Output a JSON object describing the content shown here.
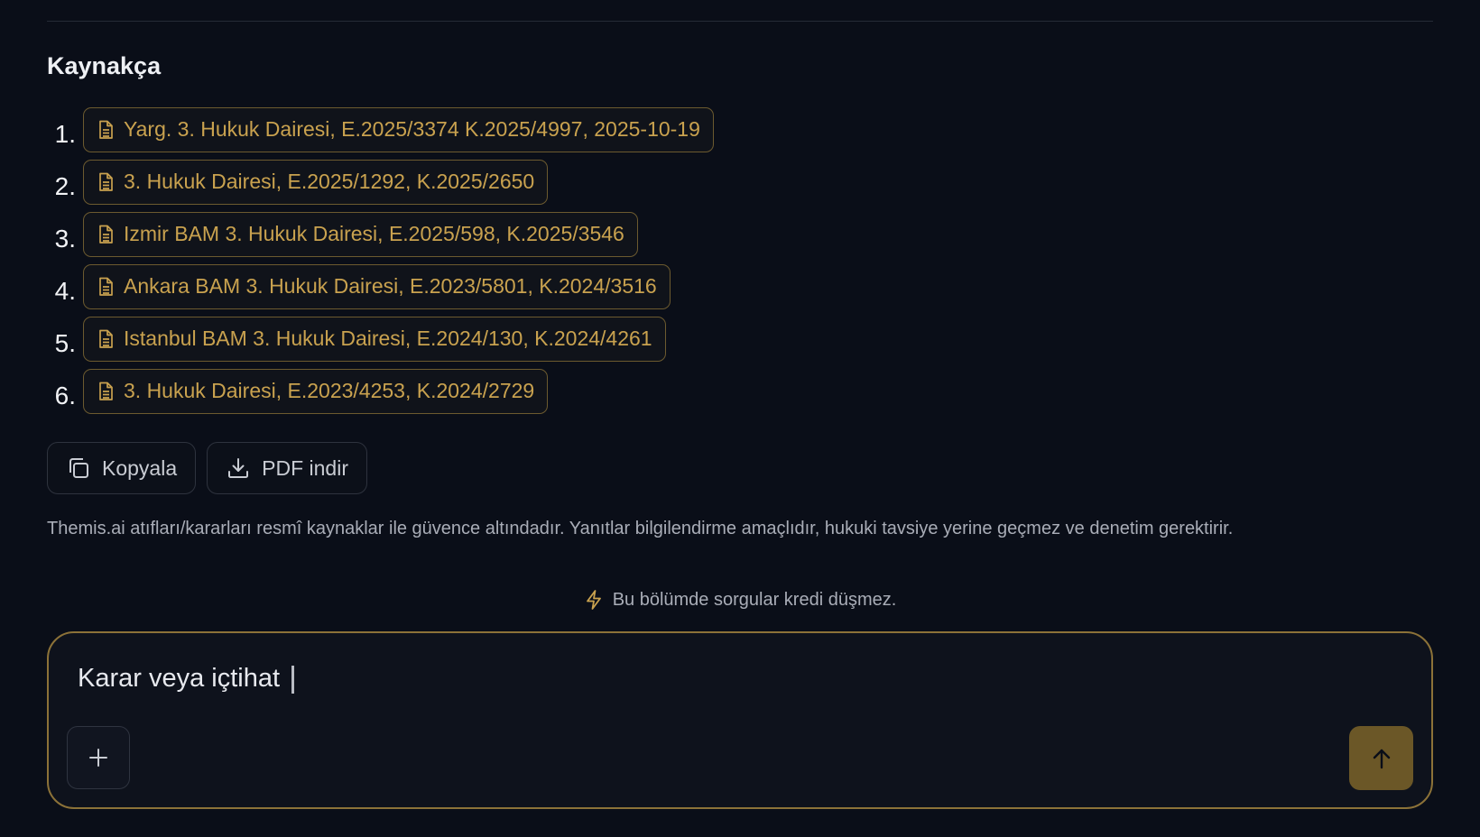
{
  "references": {
    "title": "Kaynakça",
    "items": [
      {
        "num": "1.",
        "label": "Yarg. 3. Hukuk Dairesi, E.2025/3374 K.2025/4997, 2025-10-19",
        "icon": "document-icon"
      },
      {
        "num": "2.",
        "label": "3. Hukuk Dairesi, E.2025/1292, K.2025/2650",
        "icon": "document-icon"
      },
      {
        "num": "3.",
        "label": "Izmir BAM 3. Hukuk Dairesi, E.2025/598, K.2025/3546",
        "icon": "document-icon"
      },
      {
        "num": "4.",
        "label": "Ankara BAM 3. Hukuk Dairesi, E.2023/5801, K.2024/3516",
        "icon": "document-icon"
      },
      {
        "num": "5.",
        "label": "Istanbul BAM 3. Hukuk Dairesi, E.2024/130, K.2024/4261",
        "icon": "document-icon"
      },
      {
        "num": "6.",
        "label": "3. Hukuk Dairesi, E.2023/4253, K.2024/2729",
        "icon": "document-icon"
      }
    ]
  },
  "actions": {
    "copy_label": "Kopyala",
    "copy_icon": "copy-icon",
    "pdf_label": "PDF indir",
    "pdf_icon": "download-icon"
  },
  "disclaimer": "Themis.ai atıfları/kararları resmî kaynaklar ile güvence altındadır. Yanıtlar bilgilendirme amaçlıdır, hukuki tavsiye yerine geçmez ve denetim gerektirir.",
  "credit_note": {
    "text": "Bu bölümde sorgular kredi düşmez.",
    "icon": "lightning-icon"
  },
  "composer": {
    "value": "Karar veya içtihat",
    "add_icon": "plus-icon",
    "send_icon": "arrow-up-icon"
  },
  "colors": {
    "background": "#0a0e18",
    "accent_gold": "#c9a24f",
    "chip_border": "#6c5a2f",
    "composer_border": "#8c7238",
    "send_button": "#6b5727"
  }
}
